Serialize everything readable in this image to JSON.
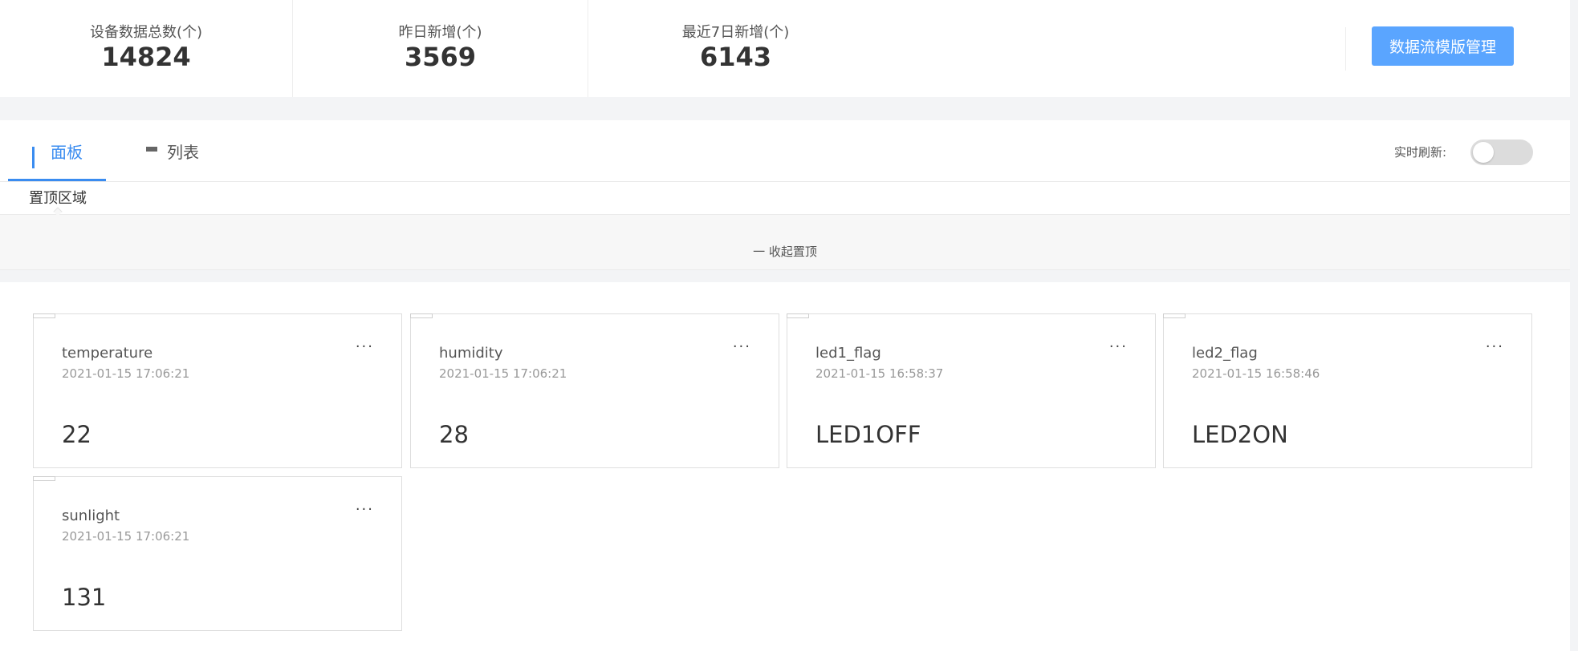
{
  "stats": [
    {
      "label": "设备数据总数(个)",
      "value": "14824"
    },
    {
      "label": "昨日新增(个)",
      "value": "3569"
    },
    {
      "label": "最近7日新增(个)",
      "value": "6143"
    }
  ],
  "template_button": "数据流模版管理",
  "tabs": [
    {
      "label": "面板",
      "icon": "grid-icon",
      "active": true
    },
    {
      "label": "列表",
      "icon": "list-icon",
      "active": false
    }
  ],
  "refresh": {
    "label": "实时刷新:",
    "enabled": false
  },
  "pin": {
    "title": "置顶区域",
    "collapse_label": "一 收起置顶"
  },
  "cards": [
    {
      "name": "temperature",
      "time": "2021-01-15 17:06:21",
      "value": "22"
    },
    {
      "name": "humidity",
      "time": "2021-01-15 17:06:21",
      "value": "28"
    },
    {
      "name": "led1_flag",
      "time": "2021-01-15 16:58:37",
      "value": "LED1OFF"
    },
    {
      "name": "led2_flag",
      "time": "2021-01-15 16:58:46",
      "value": "LED2ON"
    },
    {
      "name": "sunlight",
      "time": "2021-01-15 17:06:21",
      "value": "131"
    }
  ],
  "card_menu": "···",
  "colors": {
    "accent": "#3a8cf0",
    "button": "#5aa5ff",
    "background": "#f3f4f6"
  }
}
